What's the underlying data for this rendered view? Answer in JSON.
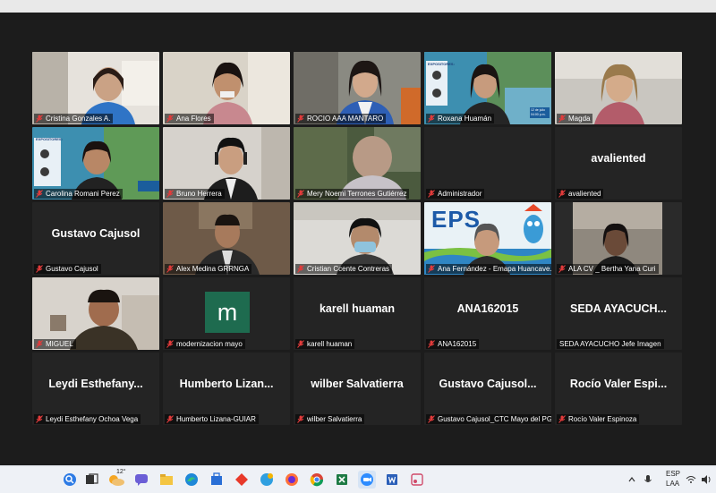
{
  "participants": [
    {
      "name": "Cristina Gonzales A.",
      "muted": true
    },
    {
      "name": "Ana Flores",
      "muted": true
    },
    {
      "name": "ROCIO AAA MANTARO",
      "muted": true
    },
    {
      "name": "Roxana Huamán",
      "muted": true,
      "active": true
    },
    {
      "name": "Magda",
      "muted": true
    },
    {
      "name": "Carolina Romani Perez",
      "muted": true
    },
    {
      "name": "Bruno Herrera",
      "muted": true
    },
    {
      "name": "Mery  Noemi Terrones Gutiérrez",
      "muted": true
    },
    {
      "name": "Administrador",
      "muted": true
    },
    {
      "name": "avaliented",
      "muted": true,
      "display": "avaliented"
    },
    {
      "name": "Gustavo Cajusol",
      "muted": true,
      "display": "Gustavo Cajusol"
    },
    {
      "name": "Alex Medina GRRNGA",
      "muted": true
    },
    {
      "name": "Cristian Ccente Contreras",
      "muted": true
    },
    {
      "name": "Ana Fernández - Emapa Huancave...",
      "muted": true
    },
    {
      "name": "ALA CV _ Bertha Yana Curi",
      "muted": true
    },
    {
      "name": "MIGUEL",
      "muted": true
    },
    {
      "name": "modernizacion mayo",
      "muted": true,
      "avatar_letter": "m"
    },
    {
      "name": "karell huaman",
      "muted": true,
      "display": "karell huaman"
    },
    {
      "name": "ANA162015",
      "muted": true,
      "display": "ANA162015"
    },
    {
      "name": "SEDA AYACUCHO Jefe Imagen",
      "muted": false,
      "display": "SEDA AYACUCH..."
    },
    {
      "name": "Leydi Esthefany Ochoa Vega",
      "muted": true,
      "display": "Leydi  Esthefany..."
    },
    {
      "name": "Humberto Lizana-GUIAR",
      "muted": true,
      "display": "Humberto  Lizan..."
    },
    {
      "name": "wilber Salvatierra",
      "muted": true,
      "display": "wilber  Salvatierra"
    },
    {
      "name": "Gustavo Cajusol_CTC Mayo del PG...",
      "muted": true,
      "display": "Gustavo  Cajusol..."
    },
    {
      "name": "Rocío Valer Espinoza",
      "muted": true,
      "display": "Rocío  Valer  Espi..."
    }
  ],
  "slide": {
    "heading": "EXPOSITORES:",
    "date": "12 de julio",
    "time": "04:00 p.m."
  },
  "eps_logo": "EPS",
  "taskbar": {
    "weather": "12°",
    "lang_top": "ESP",
    "lang_bottom": "LAA",
    "icons": [
      "search-icon",
      "task-view-icon",
      "weather-icon",
      "chat-icon",
      "file-explorer-icon",
      "edge-icon",
      "store-icon",
      "office-icon",
      "edge-alt-icon",
      "firefox-icon",
      "chrome-icon",
      "excel-icon",
      "zoom-icon",
      "word-icon",
      "snipping-icon"
    ]
  },
  "colors": {
    "active_border": "#d8e23a",
    "muted_icon": "#e23b3b",
    "tile_bg": "#242424",
    "stage_bg": "#1c1c1c"
  }
}
